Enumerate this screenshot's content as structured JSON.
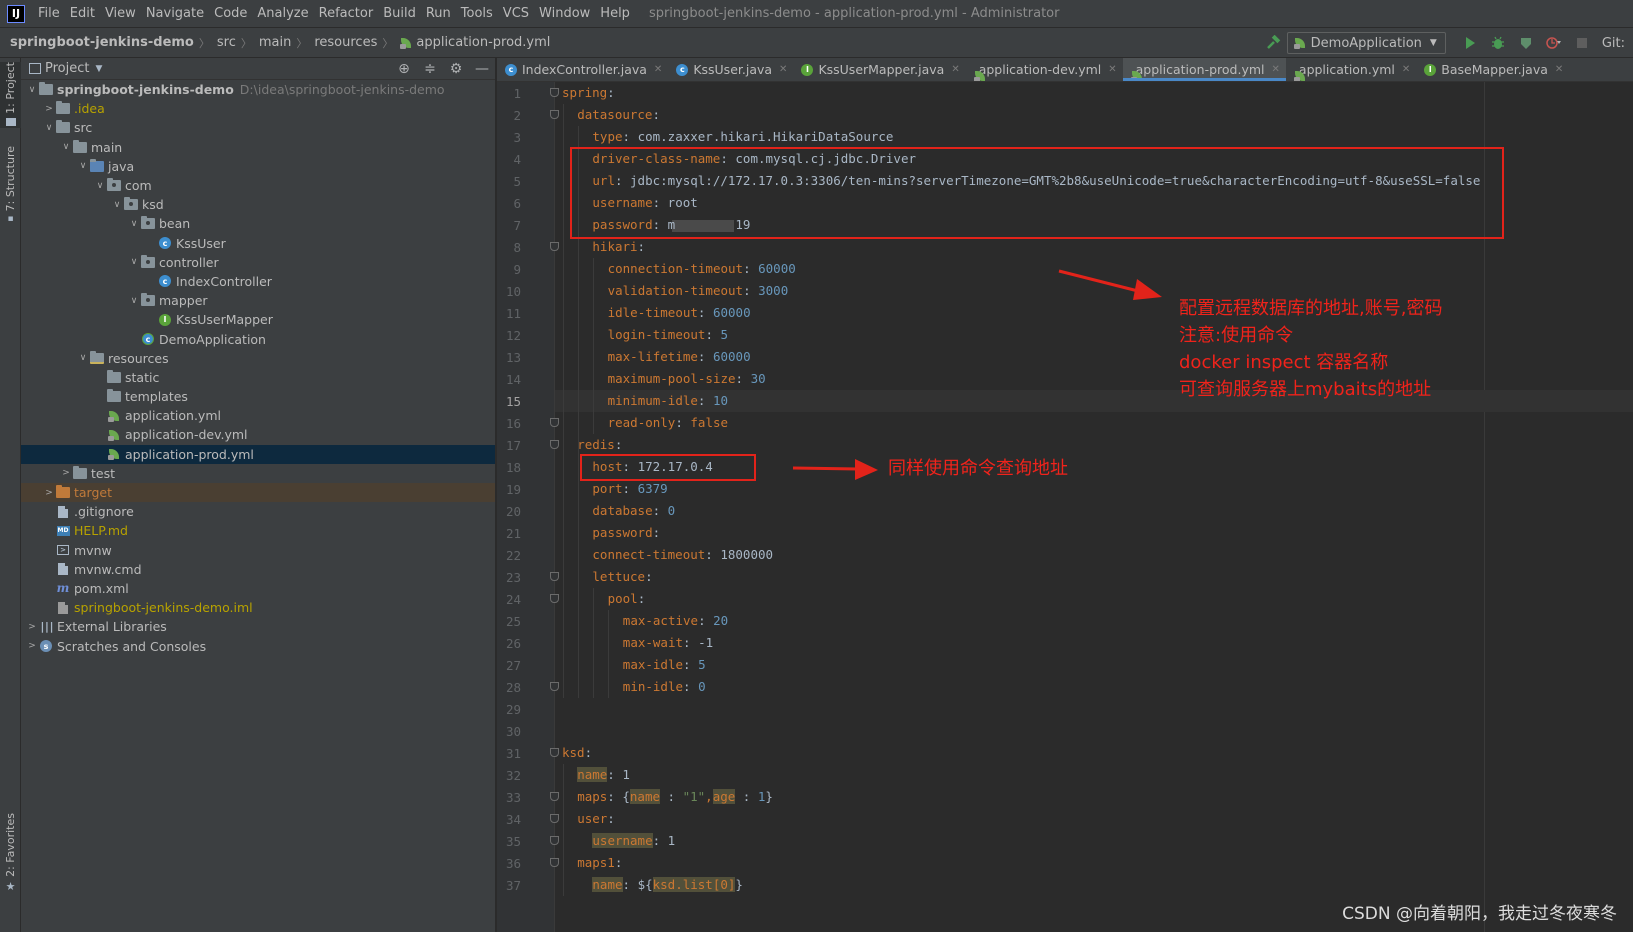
{
  "menubar": {
    "items": [
      "File",
      "Edit",
      "View",
      "Navigate",
      "Code",
      "Analyze",
      "Refactor",
      "Build",
      "Run",
      "Tools",
      "VCS",
      "Window",
      "Help"
    ],
    "window_title": "springboot-jenkins-demo - application-prod.yml - Administrator"
  },
  "breadcrumb": [
    "springboot-jenkins-demo",
    "src",
    "main",
    "resources",
    "application-prod.yml"
  ],
  "toolbar": {
    "run_config": "DemoApplication",
    "git_label": "Git:"
  },
  "tool_strip": {
    "project": "1: Project",
    "structure": "7: Structure",
    "favorites": "2: Favorites"
  },
  "project_panel": {
    "title": "Project",
    "tree": [
      {
        "label": "springboot-jenkins-demo",
        "path": "D:\\idea\\springboot-jenkins-demo",
        "depth": 0,
        "arrow": "open",
        "icon": "folder-icon",
        "bold": true
      },
      {
        "label": ".idea",
        "depth": 1,
        "arrow": "closed",
        "icon": "folder-icon",
        "color": "#b7a200"
      },
      {
        "label": "src",
        "depth": 1,
        "arrow": "open",
        "icon": "folder-icon"
      },
      {
        "label": "main",
        "depth": 2,
        "arrow": "open",
        "icon": "folder-icon"
      },
      {
        "label": "java",
        "depth": 3,
        "arrow": "open",
        "icon": "source-folder-icon"
      },
      {
        "label": "com",
        "depth": 4,
        "arrow": "open",
        "icon": "package-icon"
      },
      {
        "label": "ksd",
        "depth": 5,
        "arrow": "open",
        "icon": "package-icon"
      },
      {
        "label": "bean",
        "depth": 6,
        "arrow": "open",
        "icon": "package-icon"
      },
      {
        "label": "KssUser",
        "depth": 7,
        "arrow": "none",
        "icon": "class-icon"
      },
      {
        "label": "controller",
        "depth": 6,
        "arrow": "open",
        "icon": "package-icon"
      },
      {
        "label": "IndexController",
        "depth": 7,
        "arrow": "none",
        "icon": "class-icon"
      },
      {
        "label": "mapper",
        "depth": 6,
        "arrow": "open",
        "icon": "package-icon"
      },
      {
        "label": "KssUserMapper",
        "depth": 7,
        "arrow": "none",
        "icon": "interface-icon"
      },
      {
        "label": "DemoApplication",
        "depth": 6,
        "arrow": "none",
        "icon": "spring-app-icon"
      },
      {
        "label": "resources",
        "depth": 3,
        "arrow": "open",
        "icon": "resources-folder-icon"
      },
      {
        "label": "static",
        "depth": 4,
        "arrow": "none",
        "icon": "folder-icon"
      },
      {
        "label": "templates",
        "depth": 4,
        "arrow": "none",
        "icon": "folder-icon"
      },
      {
        "label": "application.yml",
        "depth": 4,
        "arrow": "none",
        "icon": "spring-yaml-icon"
      },
      {
        "label": "application-dev.yml",
        "depth": 4,
        "arrow": "none",
        "icon": "spring-yaml-icon"
      },
      {
        "label": "application-prod.yml",
        "depth": 4,
        "arrow": "none",
        "icon": "spring-yaml-icon",
        "selected": true
      },
      {
        "label": "test",
        "depth": 2,
        "arrow": "closed",
        "icon": "folder-icon"
      },
      {
        "label": "target",
        "depth": 1,
        "arrow": "closed",
        "icon": "excluded-folder-icon",
        "color": "#c07a3a",
        "excluded": true
      },
      {
        "label": ".gitignore",
        "depth": 1,
        "arrow": "none",
        "icon": "file-icon"
      },
      {
        "label": "HELP.md",
        "depth": 1,
        "arrow": "none",
        "icon": "markdown-icon",
        "color": "#b7a200"
      },
      {
        "label": "mvnw",
        "depth": 1,
        "arrow": "none",
        "icon": "terminal-file-icon"
      },
      {
        "label": "mvnw.cmd",
        "depth": 1,
        "arrow": "none",
        "icon": "file-icon"
      },
      {
        "label": "pom.xml",
        "depth": 1,
        "arrow": "none",
        "icon": "maven-icon"
      },
      {
        "label": "springboot-jenkins-demo.iml",
        "depth": 1,
        "arrow": "none",
        "icon": "module-file-icon",
        "color": "#b7a200"
      },
      {
        "label": "External Libraries",
        "depth": 0,
        "arrow": "closed",
        "icon": "libraries-icon"
      },
      {
        "label": "Scratches and Consoles",
        "depth": 0,
        "arrow": "closed",
        "icon": "scratches-icon"
      }
    ]
  },
  "editor_tabs": [
    {
      "label": "IndexController.java",
      "icon": "class-icon"
    },
    {
      "label": "KssUser.java",
      "icon": "class-icon"
    },
    {
      "label": "KssUserMapper.java",
      "icon": "interface-icon"
    },
    {
      "label": "application-dev.yml",
      "icon": "spring-yaml-icon"
    },
    {
      "label": "application-prod.yml",
      "icon": "spring-yaml-icon",
      "active": true
    },
    {
      "label": "application.yml",
      "icon": "spring-yaml-icon"
    },
    {
      "label": "BaseMapper.java",
      "icon": "interface-icon"
    }
  ],
  "editor": {
    "current_line": 15,
    "lines": [
      {
        "n": 1,
        "indent": 0,
        "key": "spring",
        "sep": ":",
        "val": ""
      },
      {
        "n": 2,
        "indent": 1,
        "key": "datasource",
        "sep": ":",
        "val": ""
      },
      {
        "n": 3,
        "indent": 2,
        "key": "type",
        "sep": ": ",
        "val": "com.zaxxer.hikari.HikariDataSource",
        "kind": "str"
      },
      {
        "n": 4,
        "indent": 2,
        "key": "driver-class-name",
        "sep": ": ",
        "val": "com.mysql.cj.jdbc.Driver",
        "kind": "str"
      },
      {
        "n": 5,
        "indent": 2,
        "key": "url",
        "sep": ": ",
        "val": "jdbc:mysql://172.17.0.3:3306/ten-mins?serverTimezone=GMT%2b8&useUnicode=true&characterEncoding=utf-8&useSSL=false",
        "kind": "str"
      },
      {
        "n": 6,
        "indent": 2,
        "key": "username",
        "sep": ": ",
        "val": "root",
        "kind": "str"
      },
      {
        "n": 7,
        "indent": 2,
        "key": "password",
        "sep": ": ",
        "val": "m        19",
        "kind": "str",
        "redacted": true
      },
      {
        "n": 8,
        "indent": 2,
        "key": "hikari",
        "sep": ":",
        "val": ""
      },
      {
        "n": 9,
        "indent": 3,
        "key": "connection-timeout",
        "sep": ": ",
        "val": "60000",
        "kind": "num"
      },
      {
        "n": 10,
        "indent": 3,
        "key": "validation-timeout",
        "sep": ": ",
        "val": "3000",
        "kind": "num"
      },
      {
        "n": 11,
        "indent": 3,
        "key": "idle-timeout",
        "sep": ": ",
        "val": "60000",
        "kind": "num"
      },
      {
        "n": 12,
        "indent": 3,
        "key": "login-timeout",
        "sep": ": ",
        "val": "5",
        "kind": "num"
      },
      {
        "n": 13,
        "indent": 3,
        "key": "max-lifetime",
        "sep": ": ",
        "val": "60000",
        "kind": "num"
      },
      {
        "n": 14,
        "indent": 3,
        "key": "maximum-pool-size",
        "sep": ": ",
        "val": "30",
        "kind": "num"
      },
      {
        "n": 15,
        "indent": 3,
        "key": "minimum-idle",
        "sep": ": ",
        "val": "10",
        "kind": "num"
      },
      {
        "n": 16,
        "indent": 3,
        "key": "read-only",
        "sep": ": ",
        "val": "false",
        "kind": "kw"
      },
      {
        "n": 17,
        "indent": 1,
        "key": "redis",
        "sep": ":",
        "val": ""
      },
      {
        "n": 18,
        "indent": 2,
        "key": "host",
        "sep": ": ",
        "val": "172.17.0.4",
        "kind": "str"
      },
      {
        "n": 19,
        "indent": 2,
        "key": "port",
        "sep": ": ",
        "val": "6379",
        "kind": "num"
      },
      {
        "n": 20,
        "indent": 2,
        "key": "database",
        "sep": ": ",
        "val": "0",
        "kind": "num"
      },
      {
        "n": 21,
        "indent": 2,
        "key": "password",
        "sep": ":",
        "val": ""
      },
      {
        "n": 22,
        "indent": 2,
        "key": "connect-timeout",
        "sep": ": ",
        "val": "1800000",
        "kind": "str"
      },
      {
        "n": 23,
        "indent": 2,
        "key": "lettuce",
        "sep": ":",
        "val": ""
      },
      {
        "n": 24,
        "indent": 3,
        "key": "pool",
        "sep": ":",
        "val": ""
      },
      {
        "n": 25,
        "indent": 4,
        "key": "max-active",
        "sep": ": ",
        "val": "20",
        "kind": "num"
      },
      {
        "n": 26,
        "indent": 4,
        "key": "max-wait",
        "sep": ": ",
        "val": "-1",
        "kind": "str"
      },
      {
        "n": 27,
        "indent": 4,
        "key": "max-idle",
        "sep": ": ",
        "val": "5",
        "kind": "num"
      },
      {
        "n": 28,
        "indent": 4,
        "key": "min-idle",
        "sep": ": ",
        "val": "0",
        "kind": "num"
      },
      {
        "n": 29,
        "indent": 0,
        "key": "",
        "sep": "",
        "val": ""
      },
      {
        "n": 30,
        "indent": 0,
        "key": "",
        "sep": "",
        "val": ""
      },
      {
        "n": 31,
        "indent": 0,
        "key": "ksd",
        "sep": ":",
        "val": ""
      },
      {
        "n": 32,
        "indent": 1,
        "key": "name",
        "sep": ": ",
        "val": "1",
        "kind": "str",
        "hl_key": true
      },
      {
        "n": 33,
        "indent": 1,
        "key": "maps",
        "sep": ": ",
        "val": "",
        "kind": "map"
      },
      {
        "n": 34,
        "indent": 1,
        "key": "user",
        "sep": ":",
        "val": ""
      },
      {
        "n": 35,
        "indent": 2,
        "key": "username",
        "sep": ": ",
        "val": "1",
        "kind": "str",
        "hl_key": true
      },
      {
        "n": 36,
        "indent": 1,
        "key": "maps1",
        "sep": ":",
        "val": ""
      },
      {
        "n": 37,
        "indent": 2,
        "key": "name",
        "sep": ": ",
        "val": "${ksd.list[0]}",
        "kind": "placeholder",
        "hl_key": true
      }
    ],
    "line33_parts": {
      "open": "{",
      "k1": "name",
      "mid1": " : ",
      "v1": "\"1\"",
      "comma": ",",
      "k2": "age",
      "mid2": " : ",
      "v2": "1",
      "close": "}"
    },
    "line37_parts": {
      "pre": "${",
      "ref": "ksd.list[0]",
      "post": "}"
    }
  },
  "annotations": {
    "datasource_note": [
      "配置远程数据库的地址,账号,密码",
      "注意:使用命令",
      "docker inspect 容器名称",
      "可查询服务器上mybaits的地址"
    ],
    "redis_note": "同样使用命令查询地址",
    "watermark": "CSDN @向着朝阳，我走过冬夜寒冬",
    "color": "#f0231b"
  }
}
